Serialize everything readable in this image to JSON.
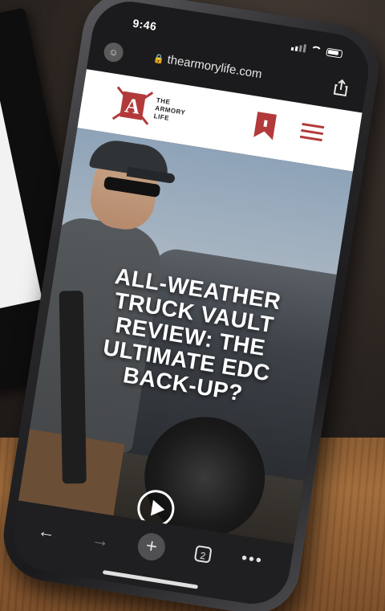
{
  "status_bar": {
    "time": "9:46"
  },
  "browser": {
    "url": "thearmorylife.com",
    "tab_count": "2"
  },
  "site": {
    "logo_letter": "A",
    "logo_name_lines": [
      "THE",
      "ARMORY",
      "LIFE"
    ],
    "brand_color": "#b23a3a"
  },
  "article": {
    "headline_lines": [
      "ALL-WEATHER",
      "TRUCK VAULT",
      "REVIEW: THE",
      "ULTIMATE EDC",
      "BACK-UP?"
    ]
  },
  "icons": {
    "back": "back-arrow-icon",
    "forward": "forward-arrow-icon",
    "new_tab": "plus-icon",
    "tabs": "tabs-icon",
    "more": "more-icon",
    "share": "share-icon",
    "bookmark": "bookmark-icon",
    "menu": "hamburger-icon",
    "play": "play-icon"
  }
}
